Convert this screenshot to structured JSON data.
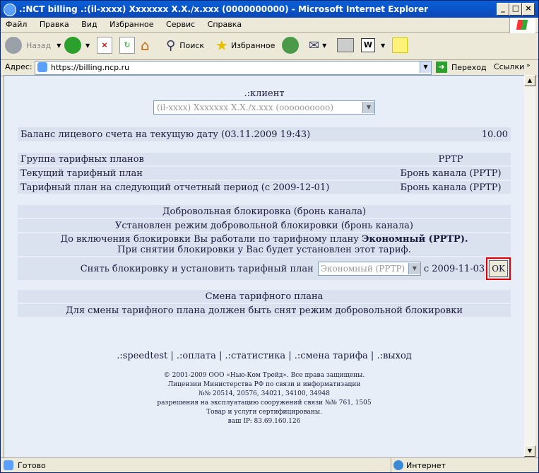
{
  "window": {
    "title": ".:NCT billing .:(il-xxxx) Xxxxxxx X.X./x.xxx (0000000000) - Microsoft Internet Explorer",
    "minimize": "_",
    "maximize": "□",
    "close": "×"
  },
  "menu": [
    "Файл",
    "Правка",
    "Вид",
    "Избранное",
    "Сервис",
    "Справка"
  ],
  "toolbar": {
    "back": "Назад",
    "search": "Поиск",
    "favorites": "Избранное"
  },
  "address": {
    "label": "Адрес:",
    "url": "https://billing.ncp.ru",
    "go": "Переход",
    "links": "Ссылки"
  },
  "page": {
    "client_heading": ".:клиент",
    "client_select": "(il-xxxx) Xxxxxxx X.X./x.xxx (oooooooooo)",
    "balance": {
      "label": "Баланс лицевого счета на текущую дату (03.11.2009 19:43)",
      "value": "10.00"
    },
    "tariff_rows": [
      {
        "label": "Группа тарифных планов",
        "value": "PPTP"
      },
      {
        "label": "Текущий тарифный план",
        "value": "Бронь канала (PPTP)"
      },
      {
        "label": "Тарифный план на следующий отчетный период (с 2009-12-01)",
        "value": "Бронь канала (PPTP)"
      }
    ],
    "block": {
      "heading": "Добровольная блокировка (бронь канала)",
      "status": "Установлен режим добровольной блокировки (бронь канала)",
      "info_prefix": "До включения блокировки Вы работали по тарифному плану ",
      "info_plan": "Экономный (PPTP).",
      "info_line2": "При снятии блокировки у Вас будет установлен этот тариф.",
      "remove_label": "Снять блокировку и установить тарифный план",
      "remove_select": "Экономный (PPTP)",
      "remove_date": "с 2009-11-03",
      "ok": "OK"
    },
    "change": {
      "heading": "Смена тарифного плана",
      "text": "Для смены тарифного плана должен быть снят режим добровольной блокировки"
    },
    "nav_links": [
      ".:speedtest",
      ".:оплата",
      ".:статистика",
      ".:смена тарифа",
      ".:выход"
    ],
    "footer": [
      "© 2001-2009 ООО «Нью-Ком Трейд». Все права защищены.",
      "Лицензии Министерства РФ по связи и информатизации",
      "№№ 20514, 20576, 34021, 34100, 34948",
      "разрешения на эксплуатацию сооружений связи №№ 761, 1505",
      "Товар и услуги сертифицированы.",
      "ваш IP: 83.69.160.126"
    ]
  },
  "status": {
    "left": "Готово",
    "zone": "Интернет"
  }
}
